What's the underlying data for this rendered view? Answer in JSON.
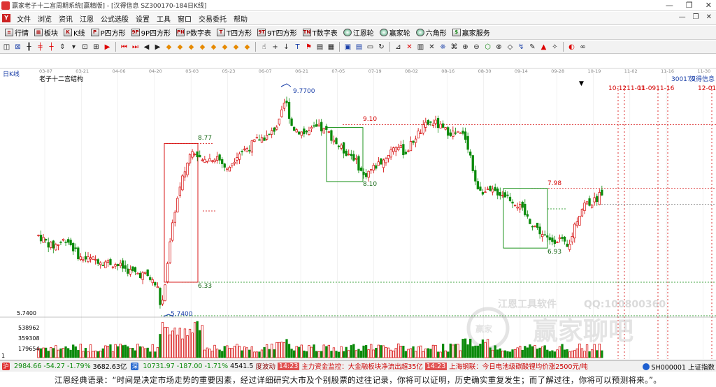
{
  "window": {
    "title": "赢家老子十二宫周期系统[赢精版] - [汉得信息 SZ300170-184日K线]",
    "controls": [
      "—",
      "❐",
      "✕"
    ]
  },
  "menu": {
    "items": [
      "文件",
      "浏览",
      "资讯",
      "江恩",
      "公式选股",
      "设置",
      "工具",
      "窗口",
      "交易委托",
      "帮助"
    ],
    "mdi": [
      "—",
      "❐",
      "✕"
    ]
  },
  "toolbar1": {
    "items": [
      {
        "label": "行情",
        "icon": "quote-icon"
      },
      {
        "label": "板块",
        "icon": "sector-icon"
      },
      {
        "label": "K线",
        "icon": "kline-icon"
      },
      {
        "label": "P四方形",
        "icon": "square-icon"
      },
      {
        "label": "9P四方形",
        "icon": "square-icon"
      },
      {
        "label": "P数字表",
        "icon": "table-icon"
      },
      {
        "label": "T四方形",
        "icon": "square-icon"
      },
      {
        "label": "9T四方形",
        "icon": "square-icon"
      },
      {
        "label": "T数字表",
        "icon": "table-icon"
      },
      {
        "label": "江恩轮",
        "icon": "wheel-icon"
      },
      {
        "label": "赢家轮",
        "icon": "wheel-icon"
      },
      {
        "label": "六角形",
        "icon": "hexagon-icon"
      },
      {
        "label": "赢家服务",
        "icon": "dollar-icon"
      }
    ]
  },
  "chart": {
    "period_label": "日K线",
    "indicator_label": "老子十二宫结构",
    "stock_code": "300170",
    "stock_name": "汉得信息",
    "top_dates": [
      "03-07",
      "03-21",
      "04-06",
      "04-20",
      "05-03",
      "05-23",
      "06-07",
      "06-21",
      "07-05",
      "07-19",
      "08-02",
      "08-16",
      "08-30",
      "09-14",
      "09-28",
      "10-19",
      "11-02",
      "11-16",
      "11-30"
    ],
    "cycle_dates": [
      "10-1211-01",
      "11-0911-16",
      "12-01"
    ],
    "price_labels": {
      "high": "9.7700",
      "box1_top": "8.77",
      "box1_bottom": "6.33",
      "box2_top": "9.10",
      "box2_bottom": "8.10",
      "box3_top": "7.98",
      "box3_bottom": "6.93",
      "low": "5.7400"
    },
    "left_axis": {
      "price": "5.7400",
      "volume_ticks": [
        "538962",
        "359308",
        "179654"
      ],
      "volume_unit": "1"
    },
    "watermark": {
      "company": "江恩工具软件",
      "qq": "QQ:100800360",
      "brand": "赢家聊吧",
      "badge": "赢家"
    }
  },
  "statusbar": {
    "sh_value": "2984.66",
    "sh_change": "-54.27",
    "sh_pct": "-1.79%",
    "sh_amount": "3682.63亿",
    "sz_value": "10731.97",
    "sz_change": "-187.00",
    "sz_pct": "-1.71%",
    "sz_amount": "4541.5",
    "news1_prefix": "度波动",
    "news1_time": "14:23",
    "news1_text": "主力资金监控：大金融板块净流出超35亿",
    "news2_time": "14:23",
    "news2_text": "上海钢联：今日电池级碳酸锂均价涨2500元/吨",
    "right_text": "SH000001 上证指数"
  },
  "quote": {
    "text": "江恩经典语录：“时间是决定市场走势的重要因素，经过详细研究大市及个别股票的过往记录，你将可以证明，历史确实重复发生；而了解过往，你将可以预测将来。”。"
  },
  "colors": {
    "up": "#d40000",
    "down": "#0a8a0a",
    "box_red": "#d40000",
    "box_green": "#0a8a0a",
    "cycle": "#d40000",
    "label_blue": "#1a3fa8"
  }
}
